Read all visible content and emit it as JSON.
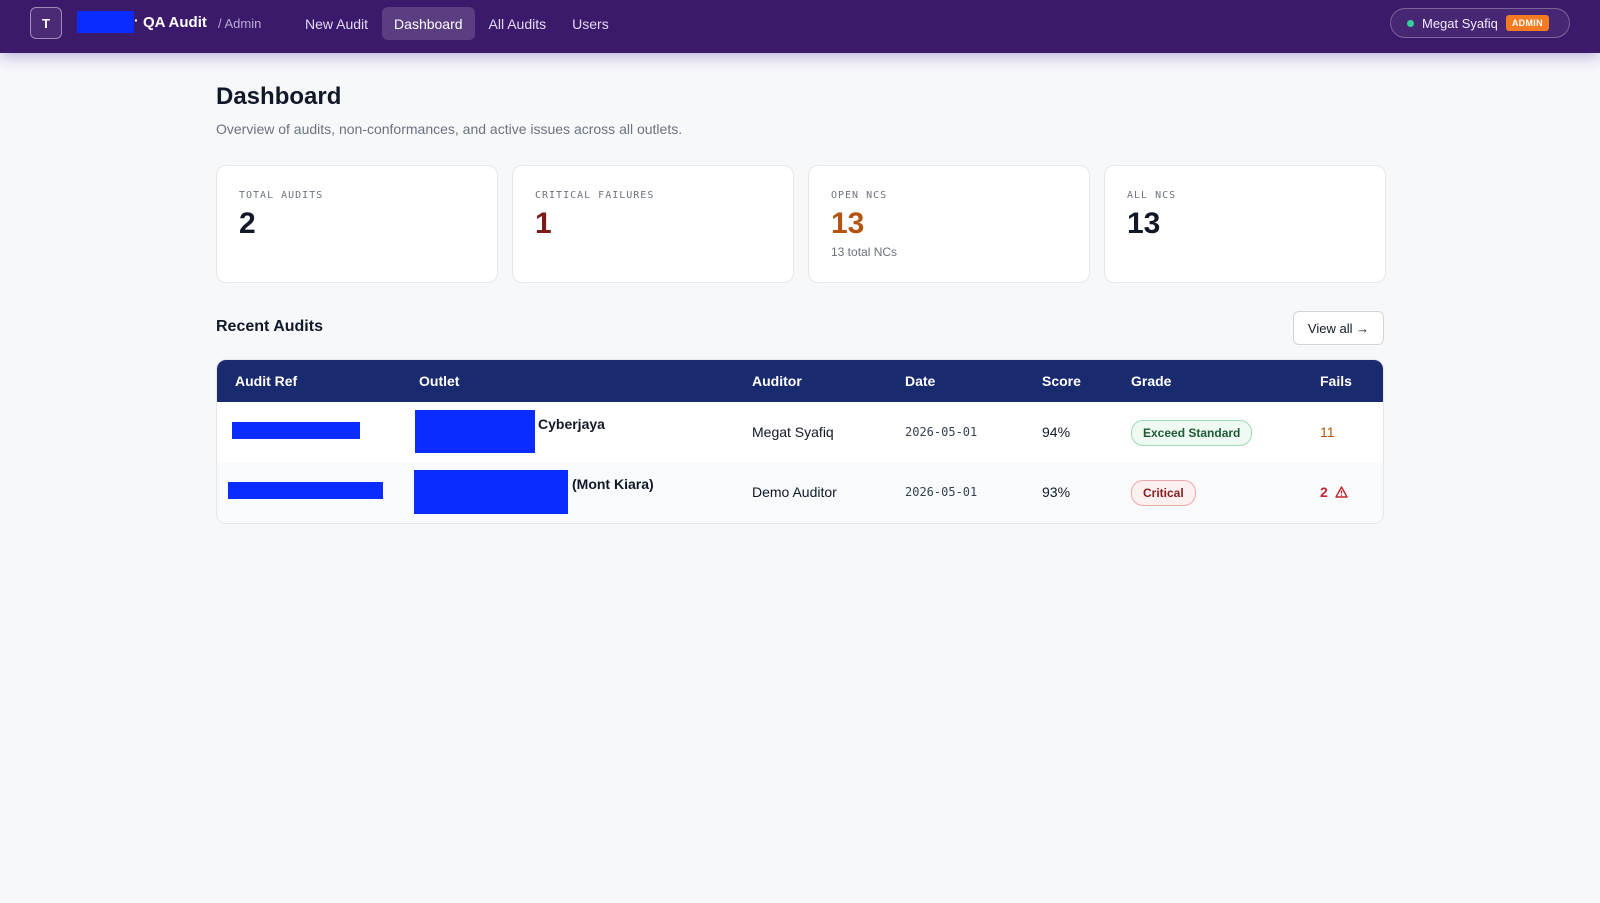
{
  "header": {
    "logo_letter": "T",
    "brand_separator": "·",
    "title": "QA Audit",
    "subtitle": "/ Admin",
    "nav": [
      {
        "label": "New Audit",
        "active": false
      },
      {
        "label": "Dashboard",
        "active": true
      },
      {
        "label": "All Audits",
        "active": false
      },
      {
        "label": "Users",
        "active": false
      }
    ],
    "user": {
      "name": "Megat Syafiq",
      "role_badge": "ADMIN",
      "status_color": "#34d399"
    }
  },
  "page": {
    "title": "Dashboard",
    "subtitle": "Overview of audits, non-conformances, and active issues across all outlets."
  },
  "stats": [
    {
      "label": "TOTAL AUDITS",
      "value": "2",
      "note": ""
    },
    {
      "label": "CRITICAL FAILURES",
      "value": "1",
      "note": ""
    },
    {
      "label": "OPEN NCS",
      "value": "13",
      "note": "13 total NCs"
    },
    {
      "label": "ALL NCS",
      "value": "13",
      "note": ""
    }
  ],
  "recent": {
    "title": "Recent Audits",
    "view_all": "View all →",
    "columns": [
      "Audit Ref",
      "Outlet",
      "Auditor",
      "Date",
      "Score",
      "Grade",
      "Fails"
    ],
    "rows": [
      {
        "outlet_suffix": "Cyberjaya",
        "auditor": "Megat Syafiq",
        "date": "2026-05-01",
        "score": "94%",
        "grade": "Exceed Standard",
        "fails": "11"
      },
      {
        "outlet_suffix": "(Mont Kiara)",
        "auditor": "Demo Auditor",
        "date": "2026-05-01",
        "score": "93%",
        "grade": "Critical",
        "fails": "2"
      }
    ]
  },
  "colors": {
    "topbar": "#3c1a6b",
    "table_header": "#1a2a6e",
    "admin_badge": "#f47b20",
    "critical_value": "#7a1a1a",
    "open_ncs_value": "#b35410",
    "redaction": "#0a2cff"
  },
  "icons": {
    "fails_warning": "warning-triangle-icon"
  }
}
